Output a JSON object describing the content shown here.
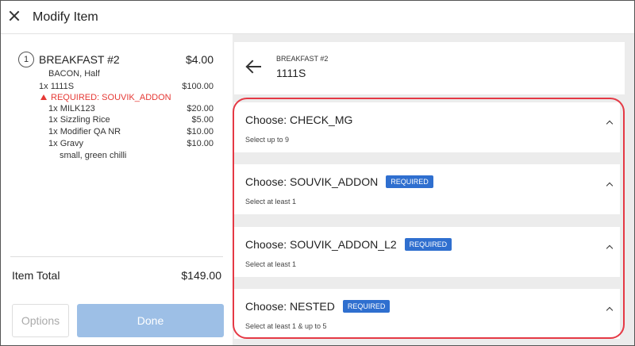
{
  "window": {
    "title": "Modify Item"
  },
  "item": {
    "index": "1",
    "name": "BREAKFAST #2",
    "price": "$4.00",
    "note": "BACON, Half"
  },
  "lines": [
    {
      "qty": "1x",
      "name": "1111S",
      "price": "$100.00"
    },
    {
      "required": "REQUIRED: SOUVIK_ADDON"
    },
    {
      "qty": "1x",
      "name": "MILK123",
      "price": "$20.00"
    },
    {
      "qty": "1x",
      "name": "Sizzling Rice",
      "price": "$5.00"
    },
    {
      "qty": "1x",
      "name": "Modifier QA NR",
      "price": "$10.00"
    },
    {
      "qty": "1x",
      "name": "Gravy",
      "price": "$10.00"
    },
    {
      "note": "small, green chilli"
    }
  ],
  "total": {
    "label": "Item Total",
    "value": "$149.00"
  },
  "buttons": {
    "options": "Options",
    "done": "Done"
  },
  "header": {
    "parent": "BREAKFAST #2",
    "name": "1111S"
  },
  "groups": [
    {
      "title": "Choose: CHECK_MG",
      "badge": "",
      "sub": "Select up to 9"
    },
    {
      "title": "Choose: SOUVIK_ADDON",
      "badge": "REQUIRED",
      "sub": "Select at least 1"
    },
    {
      "title": "Choose: SOUVIK_ADDON_L2",
      "badge": "REQUIRED",
      "sub": "Select at least 1"
    },
    {
      "title": "Choose: NESTED",
      "badge": "REQUIRED",
      "sub": "Select at least 1 & up to 5"
    }
  ],
  "colors": {
    "accent": "#2f6fcf",
    "required": "#e53935",
    "highlight": "#e53945",
    "done_button": "#9dbfe6"
  }
}
